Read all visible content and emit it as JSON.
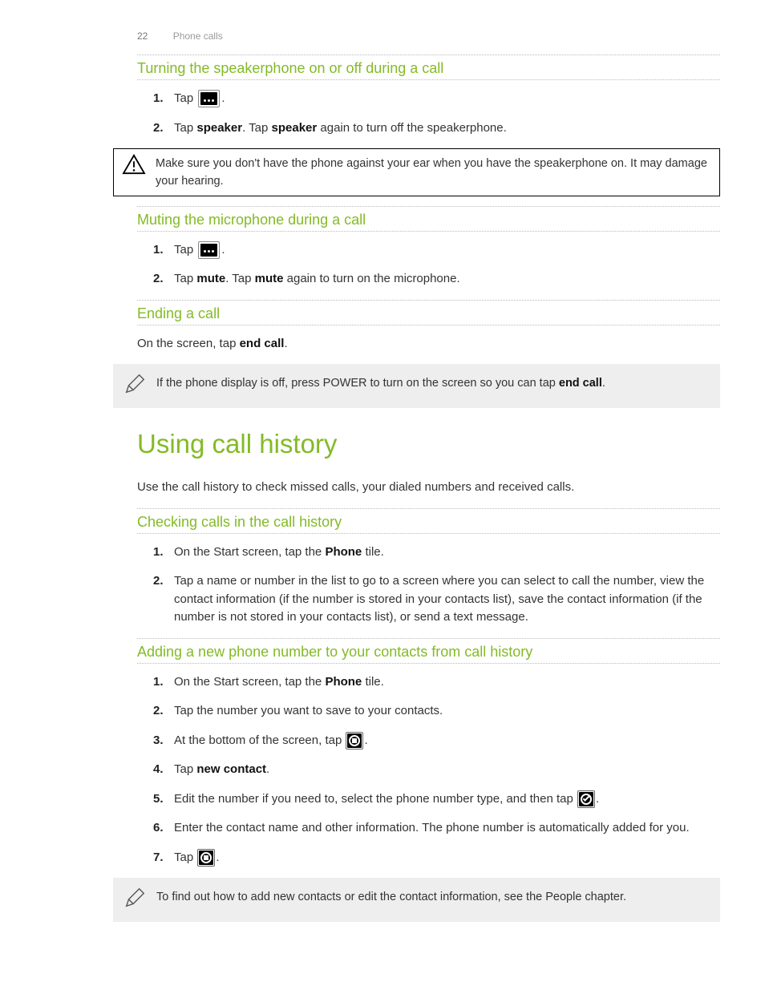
{
  "header": {
    "page_number": "22",
    "section": "Phone calls"
  },
  "s1": {
    "title": "Turning the speakerphone on or off during a call",
    "step1_pre": "Tap ",
    "step1_post": ".",
    "step2_a": "Tap ",
    "step2_b": "speaker",
    "step2_c": ". Tap ",
    "step2_d": "speaker",
    "step2_e": " again to turn off the speakerphone.",
    "warning": "Make sure you don't have the phone against your ear when you have the speakerphone on. It may damage your hearing."
  },
  "s2": {
    "title": "Muting the microphone during a call",
    "step1_pre": "Tap ",
    "step1_post": ".",
    "step2_a": "Tap ",
    "step2_b": "mute",
    "step2_c": ". Tap ",
    "step2_d": "mute",
    "step2_e": " again to turn on the microphone."
  },
  "s3": {
    "title": "Ending a call",
    "body_a": "On the screen, tap ",
    "body_b": "end call",
    "body_c": ".",
    "tip_a": "If the phone display is off, press POWER to turn on the screen so you can tap ",
    "tip_b": "end call",
    "tip_c": "."
  },
  "main": {
    "title": "Using call history",
    "intro": "Use the call history to check missed calls, your dialed numbers and received calls."
  },
  "s4": {
    "title": "Checking calls in the call history",
    "step1_a": "On the Start screen, tap the ",
    "step1_b": "Phone",
    "step1_c": " tile.",
    "step2": "Tap a name or number in the list to go to a screen where you can select to call the number, view the contact information (if the number is stored in your contacts list), save the contact information (if the number is not stored in your contacts list), or send a text message."
  },
  "s5": {
    "title": "Adding a new phone number to your contacts from call history",
    "step1_a": "On the Start screen, tap the ",
    "step1_b": "Phone",
    "step1_c": " tile.",
    "step2": "Tap the number you want to save to your contacts.",
    "step3_a": "At the bottom of the screen, tap ",
    "step3_b": ".",
    "step4_a": "Tap ",
    "step4_b": "new contact",
    "step4_c": ".",
    "step5_a": "Edit the number if you need to, select the phone number type, and then tap ",
    "step5_b": ".",
    "step6": "Enter the contact name and other information. The phone number is automatically added for you.",
    "step7_a": "Tap ",
    "step7_b": ".",
    "tip": "To find out how to add new contacts or edit the contact information, see the People chapter."
  }
}
